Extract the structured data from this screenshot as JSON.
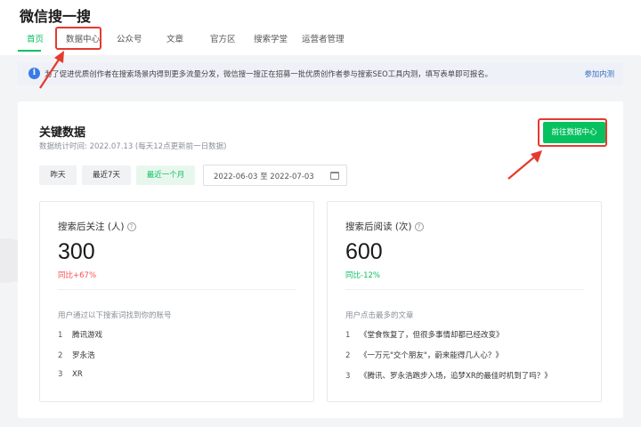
{
  "app": {
    "title": "微信搜一搜"
  },
  "nav": {
    "tabs": [
      {
        "label": "首页",
        "active": true
      },
      {
        "label": "数据中心",
        "active": false
      },
      {
        "label": "公众号",
        "active": false
      },
      {
        "label": "文章",
        "active": false
      },
      {
        "label": "官方区",
        "active": false
      },
      {
        "label": "搜索学堂",
        "active": false
      },
      {
        "label": "运营者管理",
        "active": false
      }
    ]
  },
  "notice": {
    "icon": "info-icon",
    "text": "为了促进优质创作者在搜索场景内得到更多流量分发，微信搜一搜正在招募一批优质创作者参与搜索SEO工具内测，填写表单即可报名。",
    "link": "参加内测"
  },
  "key_data": {
    "title": "关键数据",
    "subtitle": "数据统计时间: 2022.07.13 (每天12点更新前一日数据)",
    "goto_button": "前往数据中心",
    "ranges": [
      {
        "label": "昨天",
        "selected": false
      },
      {
        "label": "最近7天",
        "selected": false
      },
      {
        "label": "最近一个月",
        "selected": true
      }
    ],
    "date_range": "2022-06-03  至  2022-07-03"
  },
  "cards": {
    "follow": {
      "title": "搜索后关注 (人)",
      "value": "300",
      "change": "同比+67%",
      "list_caption": "用户通过以下搜索词找到你的账号",
      "items": [
        {
          "num": "1",
          "text": "腾讯游戏"
        },
        {
          "num": "2",
          "text": "罗永浩"
        },
        {
          "num": "3",
          "text": "XR"
        }
      ]
    },
    "read": {
      "title": "搜索后阅读 (次)",
      "value": "600",
      "change": "同比-12%",
      "list_caption": "用户点击最多的文章",
      "items": [
        {
          "num": "1",
          "text": "《堂食恢复了，但很多事情却都已经改变》"
        },
        {
          "num": "2",
          "text": "《一万元\"交个朋友\"，蔚来能得几人心？》"
        },
        {
          "num": "3",
          "text": "《腾讯、罗永浩跑步入场，追梦XR的最佳时机到了吗？》"
        }
      ]
    }
  },
  "colors": {
    "accent": "#07c160",
    "increase": "#fa5151",
    "annotation": "#e53a2e",
    "link": "#3a6fc0"
  }
}
